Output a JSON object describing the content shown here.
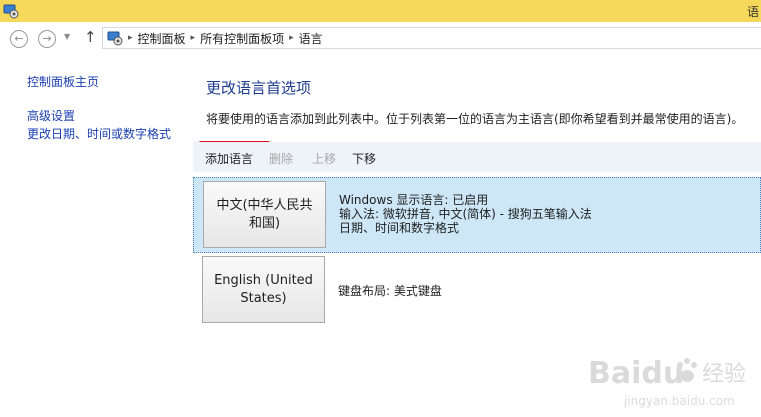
{
  "window": {
    "title_partial": "语"
  },
  "address_bar": {
    "segments": [
      "控制面板",
      "所有控制面板项",
      "语言"
    ],
    "separator": "▸"
  },
  "icons": {
    "window": "control-panel-icon",
    "address": "control-panel-icon",
    "back": "back-arrow-icon",
    "forward": "forward-arrow-icon",
    "recent": "chevron-down-icon",
    "up": "up-arrow-icon"
  },
  "nav": {
    "home": "控制面板主页",
    "advanced": "高级设置",
    "datetime": "更改日期、时间或数字格式"
  },
  "main": {
    "title": "更改语言首选项",
    "description": "将要使用的语言添加到此列表中。位于列表第一位的语言为主语言(即你希望看到并最常使用的语言)。"
  },
  "toolbar": {
    "add": "添加语言",
    "remove": "删除",
    "up": "上移",
    "down": "下移",
    "highlight_color": "#d9101c"
  },
  "languages": [
    {
      "name": "中文(中华人民共和国)",
      "details": [
        "Windows 显示语言: 已启用",
        "输入法: 微软拼音, 中文(简体) - 搜狗五笔输入法",
        "日期、时间和数字格式"
      ],
      "selected": true
    },
    {
      "name": "English (United States)",
      "details": [
        "键盘布局: 美式键盘"
      ],
      "selected": false
    }
  ],
  "watermark": {
    "brand": "Baidu",
    "product": "经验",
    "url": "jingyan.baidu.com"
  },
  "colors": {
    "titlebar": "#f6d95a",
    "link": "#1a3fb0",
    "title": "#1e3d8f",
    "toolbar_bg": "#eef2f9",
    "selected_row": "#cde7f7"
  }
}
